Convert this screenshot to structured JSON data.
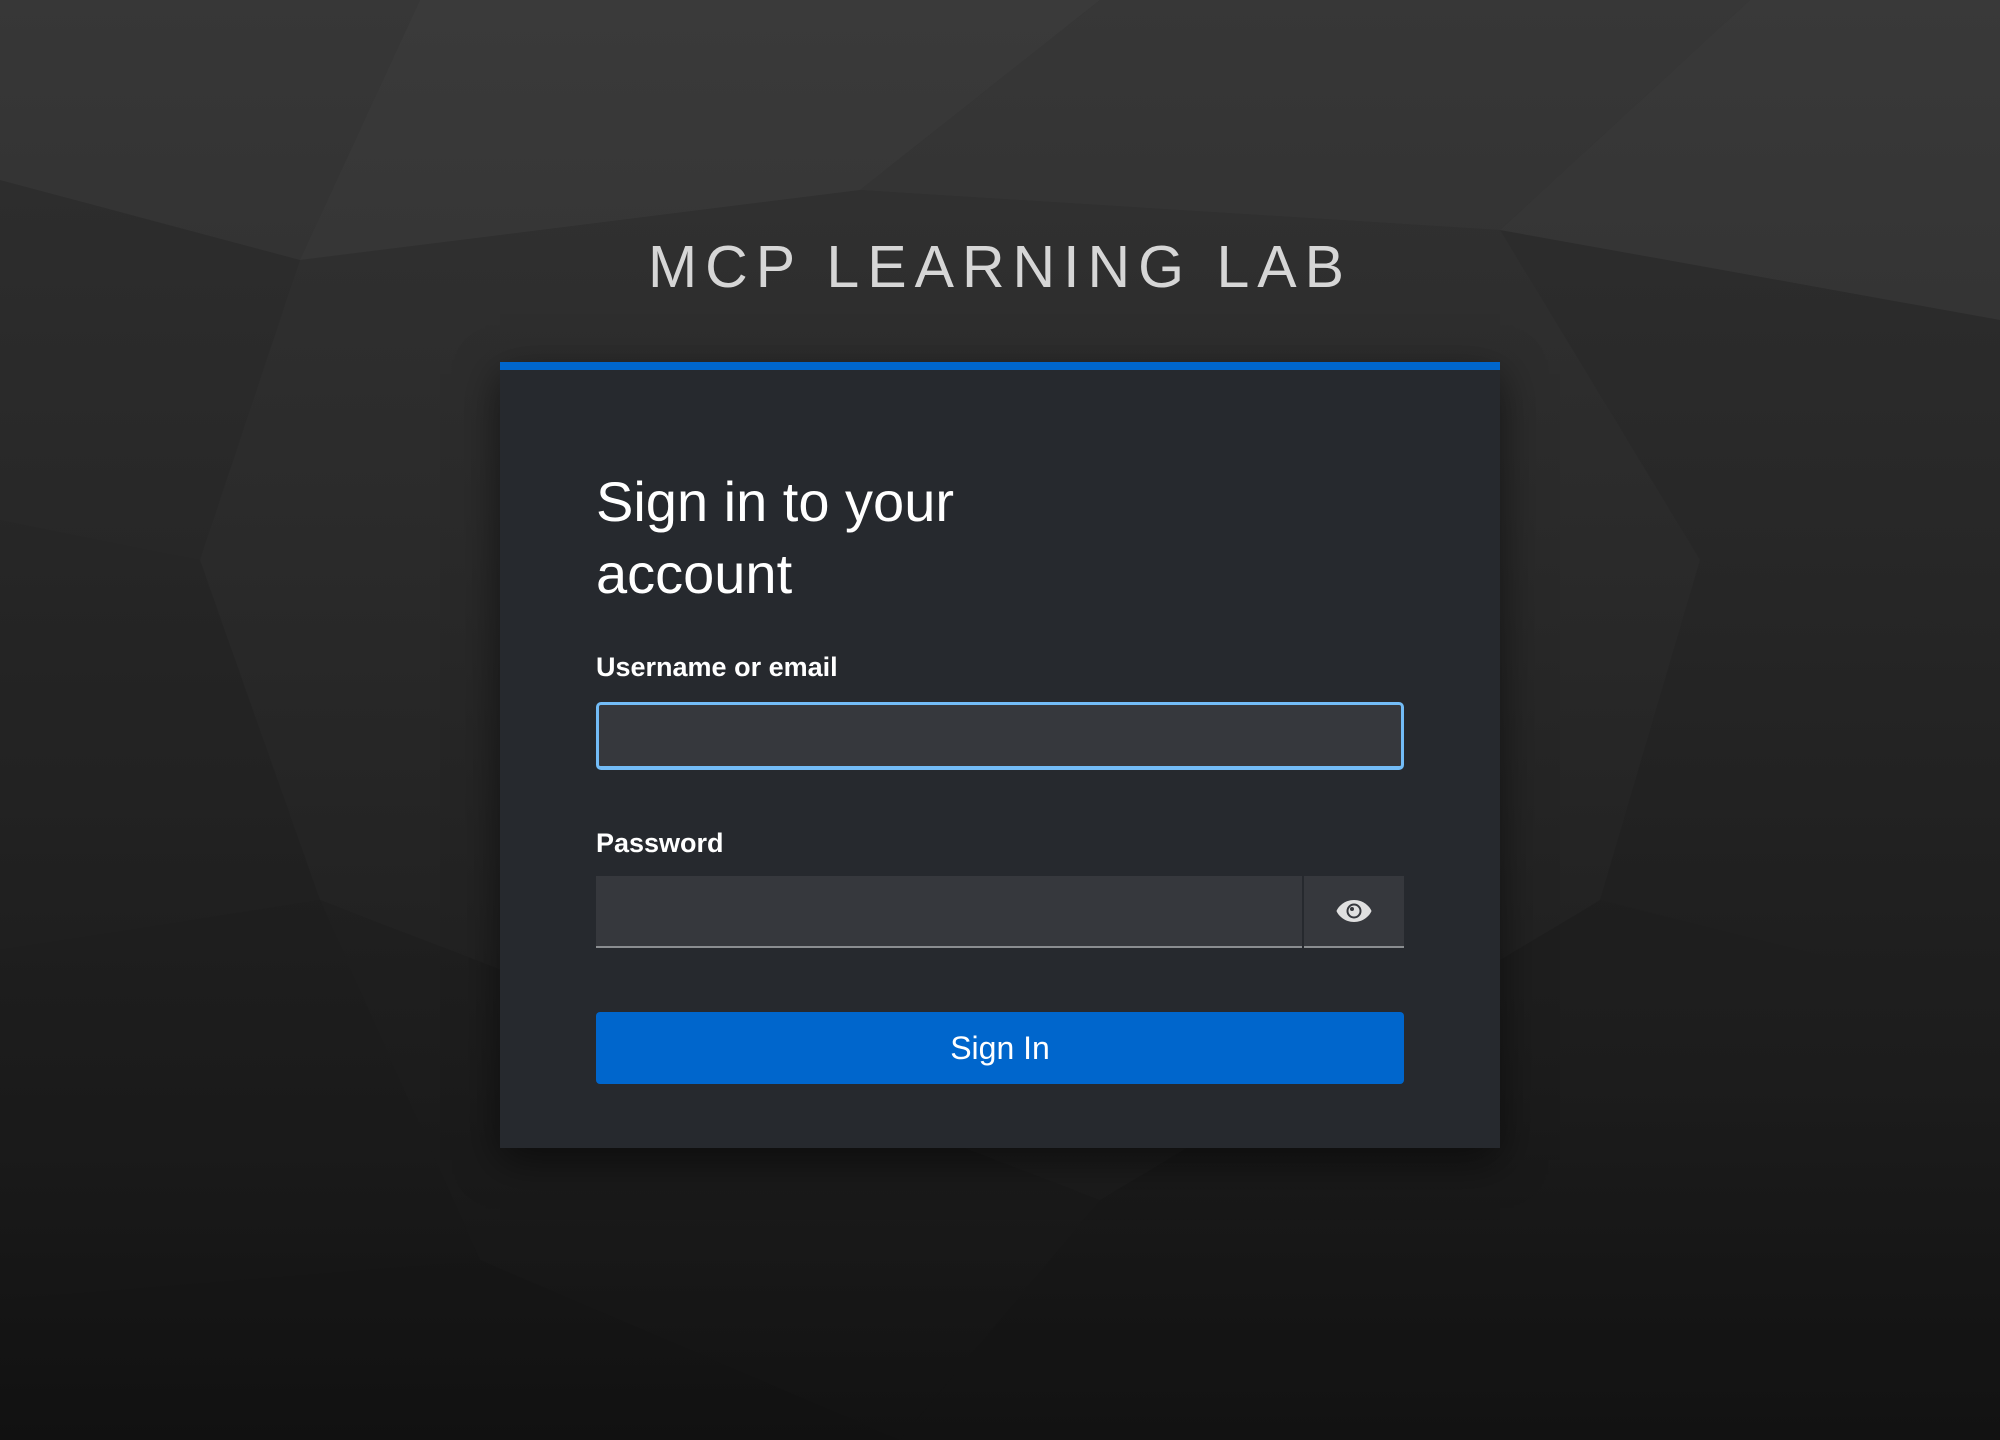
{
  "brand": {
    "title": "MCP LEARNING LAB"
  },
  "login": {
    "heading": "Sign in to your account",
    "username_label": "Username or email",
    "username_value": "",
    "password_label": "Password",
    "password_value": "",
    "password_toggle_icon": "eye-icon",
    "submit_label": "Sign In"
  },
  "colors": {
    "accent": "#0066cc",
    "focus_border": "#73bcf7",
    "card_background": "#26292e",
    "input_background": "#36383d"
  }
}
